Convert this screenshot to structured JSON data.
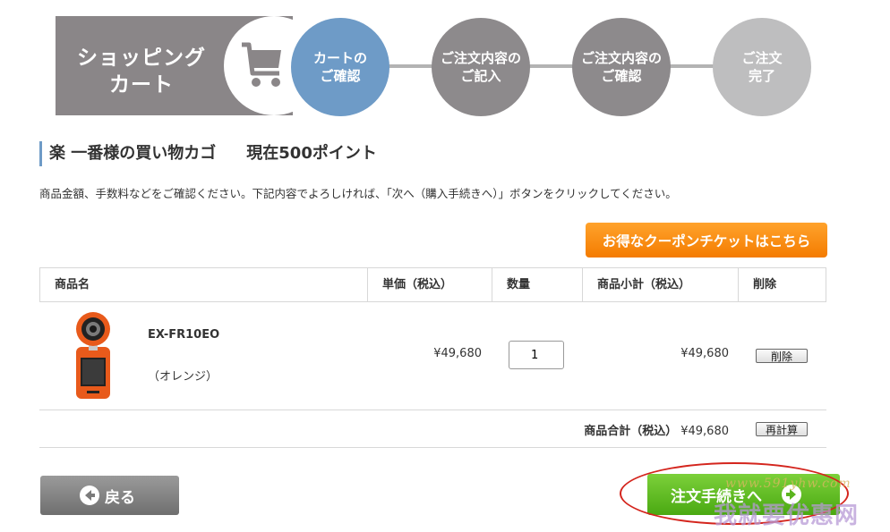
{
  "header": {
    "cart_title": "ショッピング\nカート",
    "steps": [
      "カートの\nご確認",
      "ご注文内容の\nご記入",
      "ご注文内容の\nご確認",
      "ご注文\n完了"
    ],
    "active_step": 1
  },
  "section": {
    "title": "楽 一番様の買い物カゴ",
    "points": "現在500ポイント"
  },
  "instructions": "商品金額、手数料などをご確認ください。下記内容でよろしければ、「次へ（購入手続きへ）」ボタンをクリックしてください。",
  "coupon_button": "お得なクーポンチケットはこちら",
  "table": {
    "headers": [
      "商品名",
      "単価（税込）",
      "数量",
      "商品小計（税込）",
      "削除"
    ],
    "items": [
      {
        "name": "EX-FR10EO",
        "variant": "（オレンジ）",
        "unit_price": "¥49,680",
        "quantity": "1",
        "subtotal": "¥49,680",
        "delete_label": "削除"
      }
    ],
    "total_label": "商品合計（税込）",
    "total_value": "¥49,680",
    "recalc_label": "再計算"
  },
  "buttons": {
    "back": "戻る",
    "next": "注文手続きへ"
  },
  "watermark": {
    "url": "www.591yhw.com",
    "text": "我就要优惠网"
  },
  "colors": {
    "active_step": "#6e9bc7",
    "step": "#8d8a8c",
    "step_done": "#bebebf",
    "coupon": "#f47b00",
    "next": "#4aa912",
    "highlight": "#d4251d"
  }
}
